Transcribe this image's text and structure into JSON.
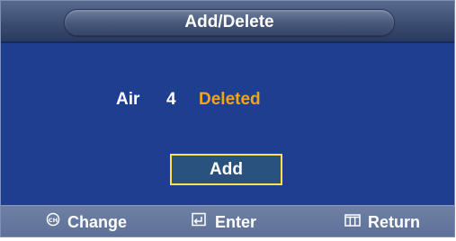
{
  "menu": {
    "title": "Add/Delete"
  },
  "channel": {
    "source": "Air",
    "number": "4",
    "status": "Deleted"
  },
  "action": {
    "label": "Add"
  },
  "footer": {
    "hints": [
      {
        "icon": "channel-icon",
        "label": "Change"
      },
      {
        "icon": "enter-icon",
        "label": "Enter"
      },
      {
        "icon": "return-icon",
        "label": "Return"
      }
    ]
  },
  "colors": {
    "background": "#1e3f8f",
    "status_deleted": "#f5a31f",
    "focus_border": "#ffe24a",
    "footer": "#6e80a4"
  }
}
